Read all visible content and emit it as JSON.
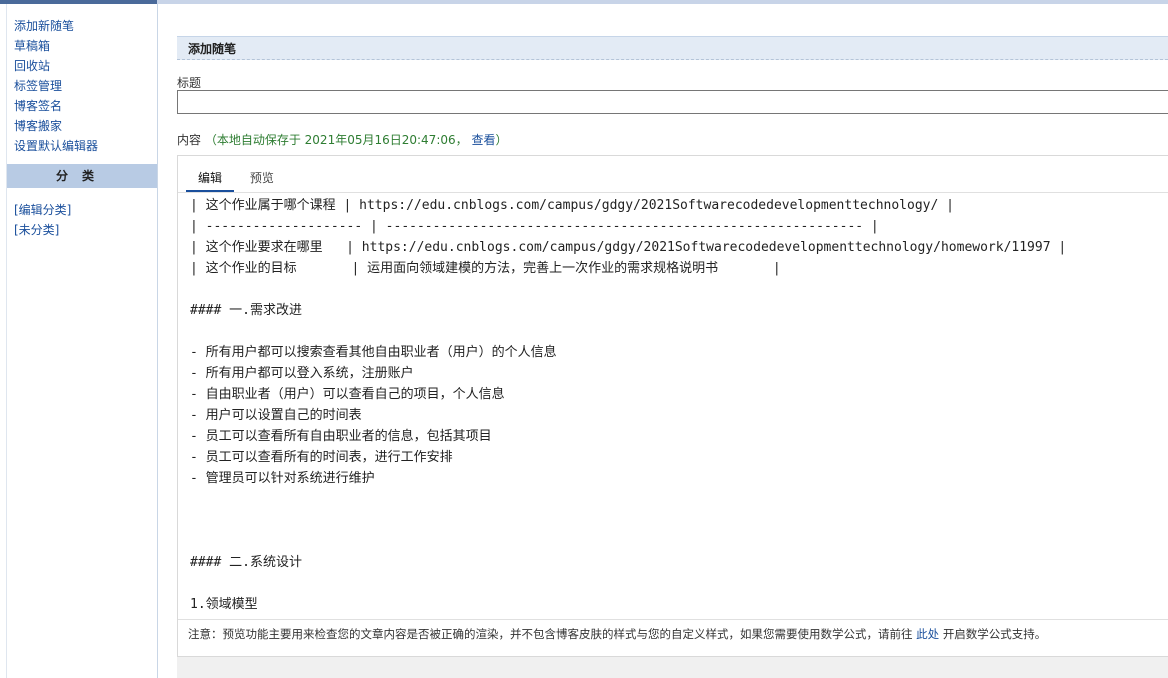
{
  "sidebar": {
    "links": [
      {
        "label": "添加新随笔"
      },
      {
        "label": "草稿箱"
      },
      {
        "label": "回收站"
      },
      {
        "label": "标签管理"
      },
      {
        "label": "博客签名"
      },
      {
        "label": "博客搬家"
      },
      {
        "label": "设置默认编辑器"
      }
    ],
    "category_header": "分类",
    "category_links": [
      {
        "label": "[编辑分类]"
      },
      {
        "label": "[未分类]"
      }
    ]
  },
  "main": {
    "section_title": "添加随笔",
    "title_label": "标题",
    "title_value": "",
    "content_label": "内容",
    "autosave_text": "（本地自动保存于 2021年05月16日20:47:06，",
    "autosave_link": "查看",
    "autosave_close": "）",
    "tabs": [
      {
        "label": "编辑"
      },
      {
        "label": "预览"
      }
    ],
    "editor_lines": [
      "| 这个作业属于哪个课程 | https://edu.cnblogs.com/campus/gdgy/2021Softwarecodedevelopmenttechnology/ |",
      "| -------------------- | ------------------------------------------------------------- |",
      "| 这个作业要求在哪里   | https://edu.cnblogs.com/campus/gdgy/2021Softwarecodedevelopmenttechnology/homework/11997 |",
      "| 这个作业的目标       | 运用面向领域建模的方法，完善上一次作业的需求规格说明书       |",
      "",
      "#### 一.需求改进",
      "",
      "- 所有用户都可以搜索查看其他自由职业者（用户）的个人信息",
      "- 所有用户都可以登入系统，注册账户",
      "- 自由职业者（用户）可以查看自己的项目，个人信息",
      "- 用户可以设置自己的时间表",
      "- 员工可以查看所有自由职业者的信息，包括其项目",
      "- 员工可以查看所有的时间表，进行工作安排",
      "- 管理员可以针对系统进行维护",
      "",
      "",
      "",
      "#### 二.系统设计",
      "",
      "1.领域模型"
    ],
    "notice_text": "注意：预览功能主要用来检查您的文章内容是否被正确的渲染，并不包含博客皮肤的样式与您的自定义样式，如果您需要使用数学公式，请前往",
    "notice_link": "此处",
    "notice_tail": "开启数学公式支持。"
  }
}
